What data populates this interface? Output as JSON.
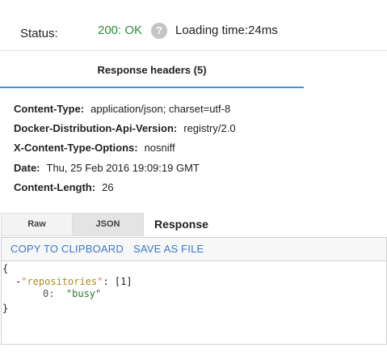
{
  "status": {
    "label": "Status:",
    "code": "200: OK",
    "help_icon": "question-icon",
    "loading_time": "Loading time:24ms",
    "code_color": "#2e8b3a"
  },
  "headers_tab": {
    "label": "Response headers",
    "count": "(5)",
    "accent": "#4a8fd6"
  },
  "headers": [
    {
      "name": "Content-Type:",
      "value": "application/json; charset=utf-8"
    },
    {
      "name": "Docker-Distribution-Api-Version:",
      "value": "registry/2.0"
    },
    {
      "name": "X-Content-Type-Options:",
      "value": "nosniff"
    },
    {
      "name": "Date:",
      "value": "Thu, 25 Feb 2016 19:09:19 GMT"
    },
    {
      "name": "Content-Length:",
      "value": "26"
    }
  ],
  "view_tabs": {
    "raw": "Raw",
    "json": "JSON",
    "selected": "JSON"
  },
  "response": {
    "title": "Response",
    "copy_label": "COPY TO CLIPBOARD",
    "save_label": "SAVE AS FILE",
    "link_color": "#3c78c8"
  },
  "json_body": {
    "open_brace": "{",
    "toggle": "-",
    "key": "\"repositories\"",
    "colon": ":",
    "array_open": "[",
    "array_count": "1",
    "array_close": "]",
    "item_index": "0:",
    "item_value": "\"busy\"",
    "close_brace": "}"
  }
}
